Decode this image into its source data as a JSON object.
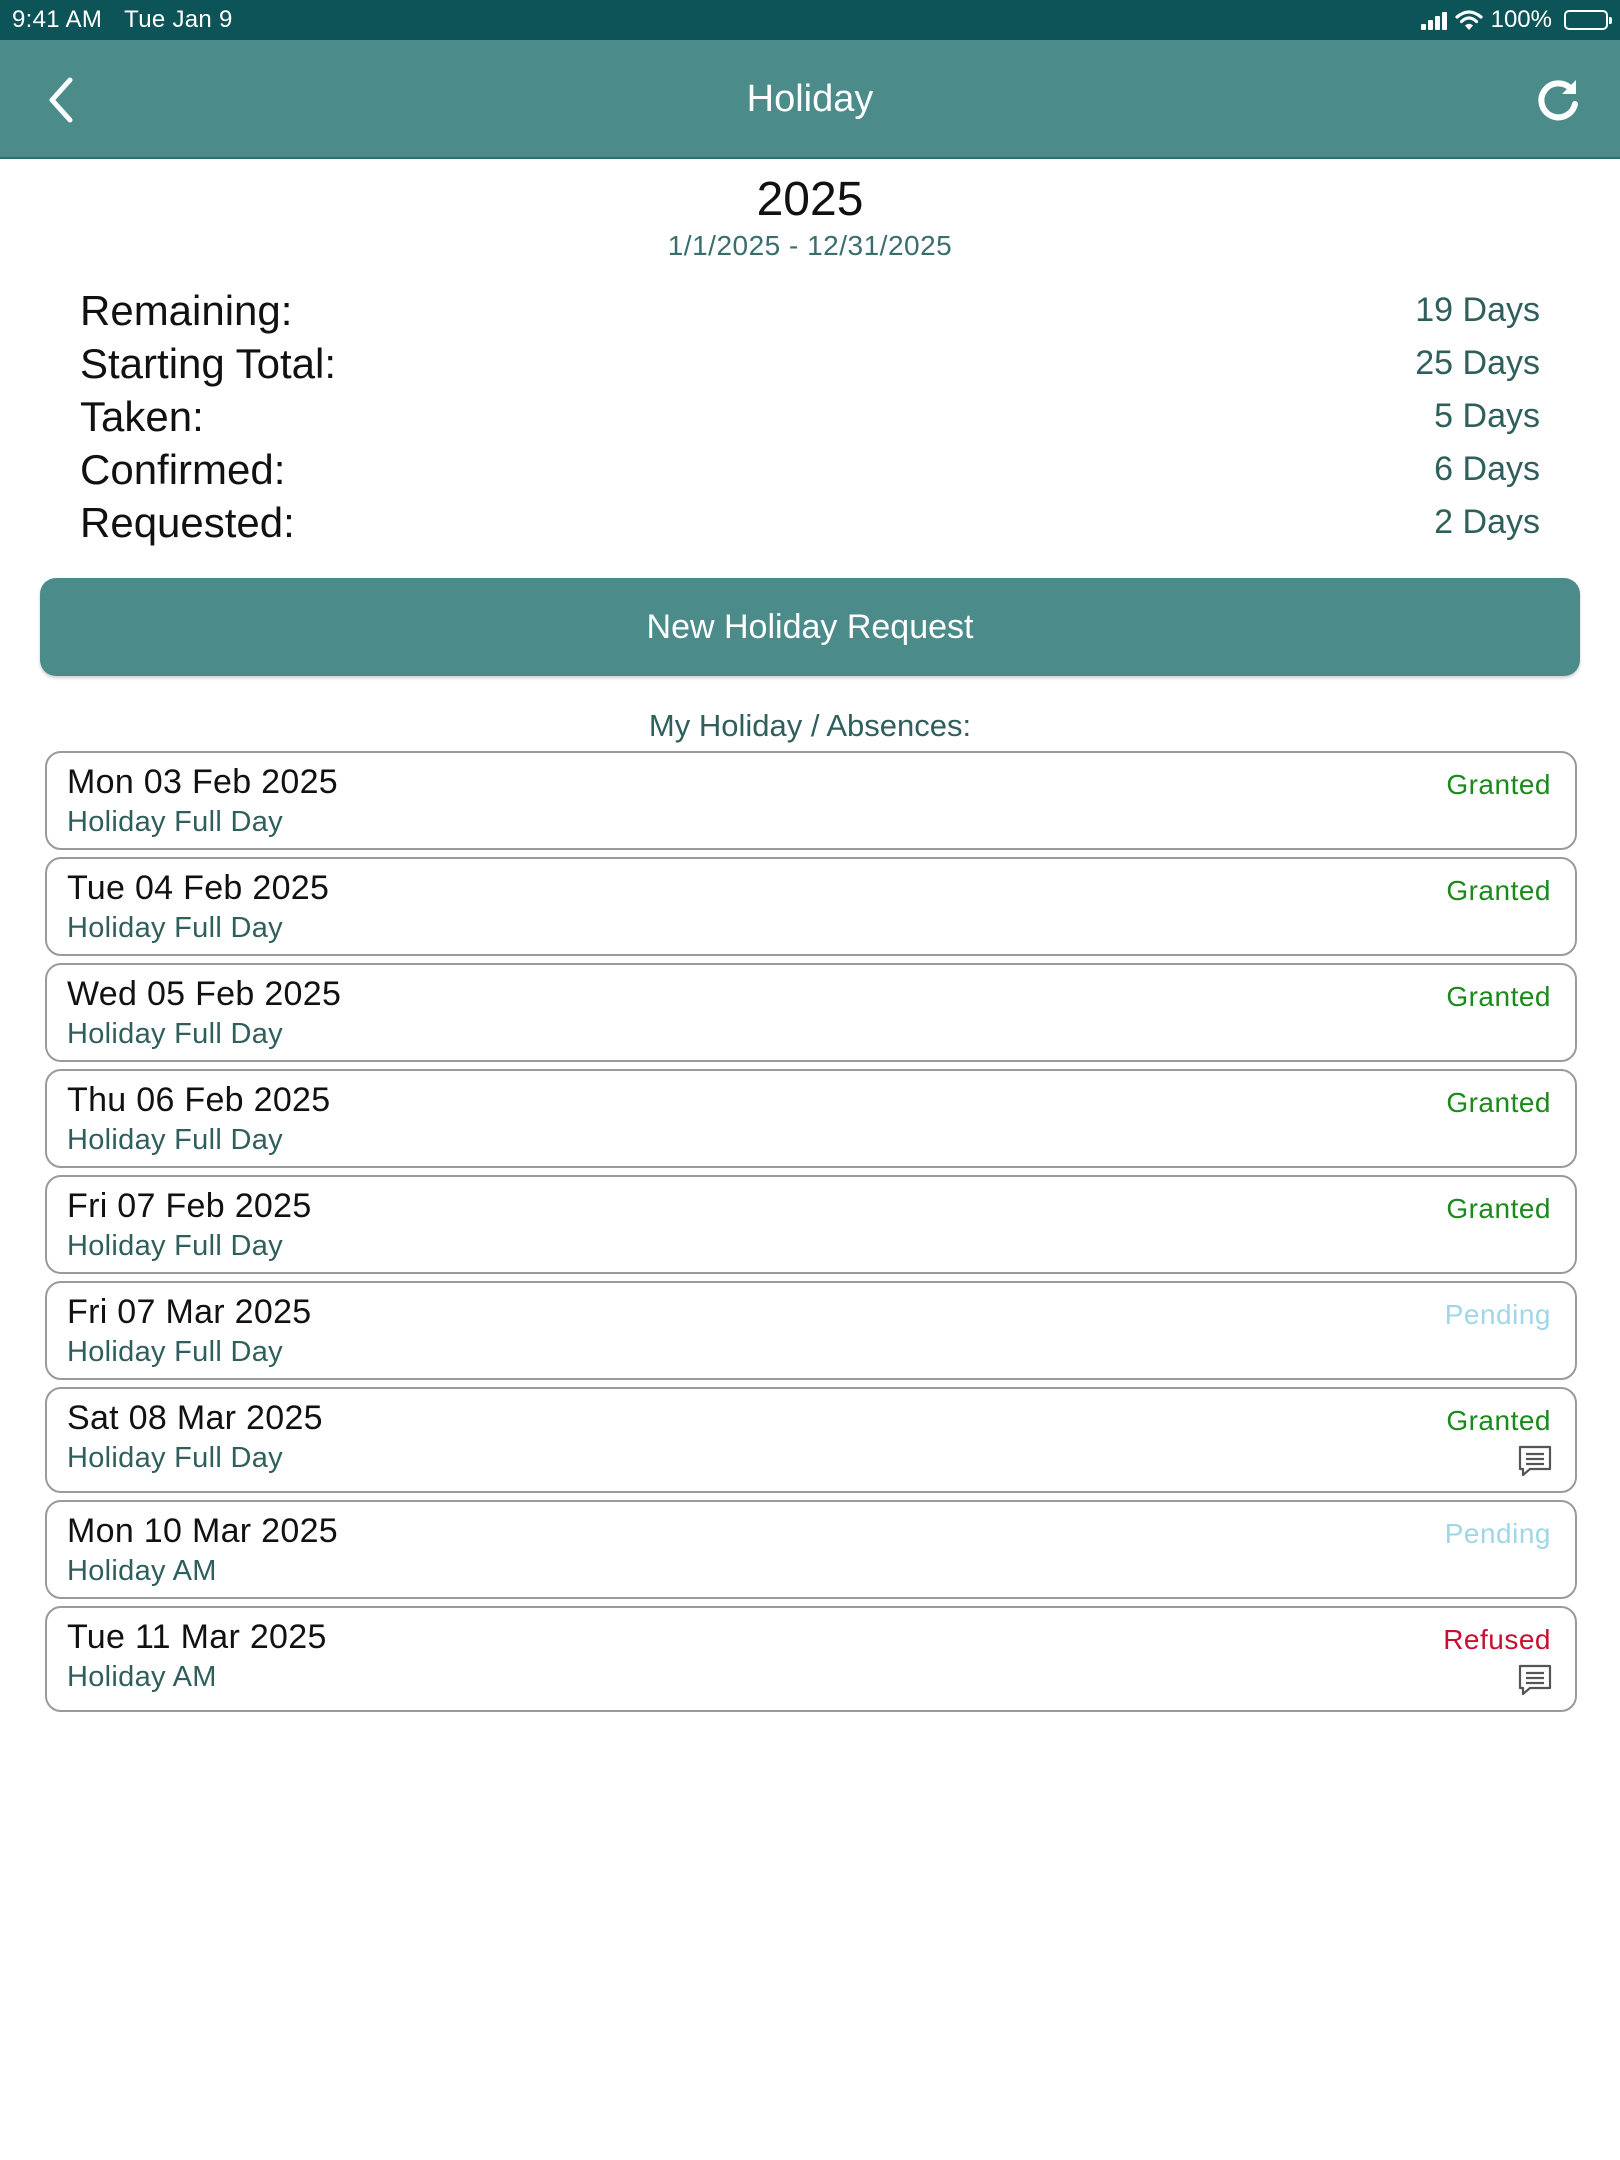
{
  "status_bar": {
    "time": "9:41 AM",
    "date": "Tue Jan 9",
    "battery": "100%",
    "icons": [
      "signal-icon",
      "wifi-icon",
      "battery-icon"
    ]
  },
  "nav": {
    "title": "Holiday",
    "back_icon": "chevron-left-icon",
    "refresh_icon": "refresh-icon"
  },
  "period": {
    "year": "2025",
    "range": "1/1/2025 - 12/31/2025"
  },
  "summary": [
    {
      "label": "Remaining:",
      "value": "19 Days"
    },
    {
      "label": "Starting Total:",
      "value": "25 Days"
    },
    {
      "label": "Taken:",
      "value": "5 Days"
    },
    {
      "label": "Confirmed:",
      "value": "6 Days"
    },
    {
      "label": "Requested:",
      "value": "2 Days"
    }
  ],
  "new_request_label": "New Holiday Request",
  "section_heading": "My Holiday / Absences:",
  "status_colors": {
    "Granted": "#1a8a1a",
    "Pending": "#9fd7e8",
    "Refused": "#c8102e"
  },
  "colors": {
    "header": "#4b8c8b",
    "status_bar": "#0d5458",
    "button": "#4b8c8b"
  },
  "entries": [
    {
      "date": "Mon 03 Feb 2025",
      "type": "Holiday Full Day",
      "status": "Granted",
      "has_comment": false
    },
    {
      "date": "Tue 04 Feb 2025",
      "type": "Holiday Full Day",
      "status": "Granted",
      "has_comment": false
    },
    {
      "date": "Wed 05 Feb 2025",
      "type": "Holiday Full Day",
      "status": "Granted",
      "has_comment": false
    },
    {
      "date": "Thu 06 Feb 2025",
      "type": "Holiday Full Day",
      "status": "Granted",
      "has_comment": false
    },
    {
      "date": "Fri 07 Feb 2025",
      "type": "Holiday Full Day",
      "status": "Granted",
      "has_comment": false
    },
    {
      "date": "Fri 07 Mar 2025",
      "type": "Holiday Full Day",
      "status": "Pending",
      "has_comment": false
    },
    {
      "date": "Sat 08 Mar 2025",
      "type": "Holiday Full Day",
      "status": "Granted",
      "has_comment": true
    },
    {
      "date": "Mon 10 Mar 2025",
      "type": "Holiday AM",
      "status": "Pending",
      "has_comment": false
    },
    {
      "date": "Tue 11 Mar 2025",
      "type": "Holiday AM",
      "status": "Refused",
      "has_comment": true
    }
  ]
}
